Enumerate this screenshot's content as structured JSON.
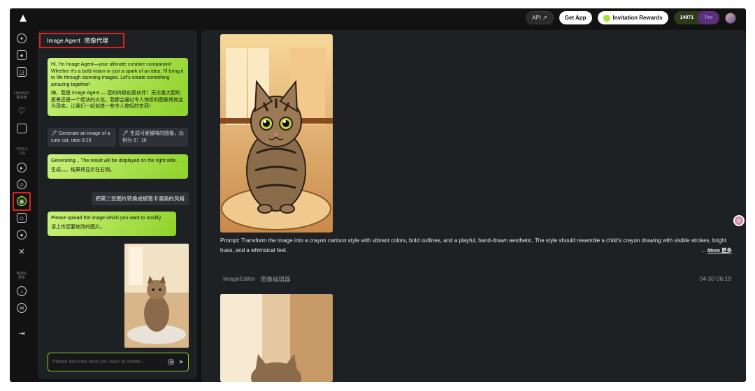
{
  "topbar": {
    "logo_icon": "brand-logo-icon",
    "api_label": "API ↗",
    "get_app_label": "Get App",
    "invite_label": "Invitation Rewards",
    "credits": "14971",
    "plan": "Pro"
  },
  "sidebar": {
    "library_label": "LIBRARY",
    "library_label_cn": "图书馆",
    "tools_label": "TOOLS",
    "tools_label_cn": "工具",
    "more_label": "MORE",
    "more_label_cn": "更多"
  },
  "chat": {
    "title": "Image Agent",
    "title_cn": "图像代理",
    "greeting_en": "Hi, I'm Image Agent—your ultimate creative companion! Whether it's a bold vision or just a spark of an idea, I'll bring it to life through stunning images. Let's create something amazing together!",
    "greeting_cn": "嗨，我是 Image Agent — 您的终极创意伙伴！无论是大胆的愿景还是一个想法的火花，我都会通过令人惊叹的图像将其变为现实。让我们一起创造一些令人惊叹的东西！",
    "suggestion_1": "🖊 Generate an image of a cute cat, ratio 9:16",
    "suggestion_2": "🖊 生成可爱猫咪的图像，比例为 9：16",
    "generating_en": "Generating... The result will be displayed on the right side.",
    "generating_cn": "生成。。。结果将显示在右侧。",
    "user_message": "把第二张图片转换成蜡笔卡通画的风格",
    "upload_en": "Please upload the image which you want to modify.",
    "upload_cn": "请上传您要修改的图片。",
    "input_placeholder": "Please describe what you want to create..."
  },
  "main": {
    "prompt": "Prompt: Transform the image into a crayon cartoon style with vibrant colors, bold outlines, and a playful, hand-drawn aesthetic. The style should resemble a child's crayon drawing with visible strokes, bright hues, and a whimsical feel.",
    "more_prefix": "...",
    "more_label": "More 更多",
    "editor_label": "ImageEditor",
    "editor_label_cn": "图像编辑器",
    "timestamp": "04-30 06:19"
  },
  "colors": {
    "accent_green": "#8fd32a",
    "highlight_red": "#e02020",
    "panel_bg": "#1e2124",
    "app_bg": "#121212"
  }
}
